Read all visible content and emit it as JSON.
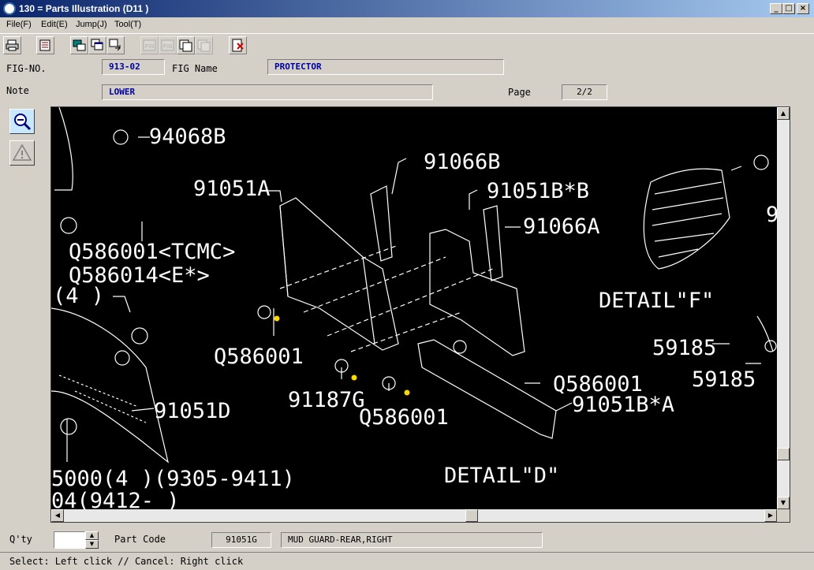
{
  "window": {
    "title": "130 = Parts Illustration (D11  )"
  },
  "window_buttons": {
    "minimize": "_",
    "maximize": "□",
    "close": "×"
  },
  "menu": [
    "File(F)",
    "Edit(E)",
    "Jump(J)",
    "Tool(T)"
  ],
  "header": {
    "fig_no_label": "FIG-NO.",
    "fig_no_value": "913-02",
    "fig_name_label": "FIG Name",
    "fig_name_value": "PROTECTOR",
    "note_label": "Note",
    "note_value": "LOWER",
    "page_label": "Page",
    "page_value": "2/2"
  },
  "drawing_labels": [
    "94068B",
    "91066B",
    "91051A",
    "91051B*B",
    "91066A",
    "Q586001<TCMC>",
    "Q586014<E*>",
    "(4 )",
    "Q586001",
    "91187G",
    "Q586001",
    "Q586001",
    "91051B*A",
    "91051D",
    "DETAIL\"F\"",
    "DETAIL\"D\"",
    "59185",
    "59185",
    "5000(4 )(9305-9411)",
    "04(9412-      )",
    "9"
  ],
  "footer": {
    "qty_label": "Q'ty",
    "qty_value": "",
    "part_code_label": "Part Code",
    "part_code_value": "91051G",
    "part_name_value": "MUD GUARD-REAR,RIGHT"
  },
  "status": {
    "text": "Select: Left click // Cancel: Right click"
  },
  "colors": {
    "titlebar": "#0a246a",
    "canvas": "#000000",
    "field_text": "#0000a0",
    "highlight_dot": "#ffd700"
  }
}
